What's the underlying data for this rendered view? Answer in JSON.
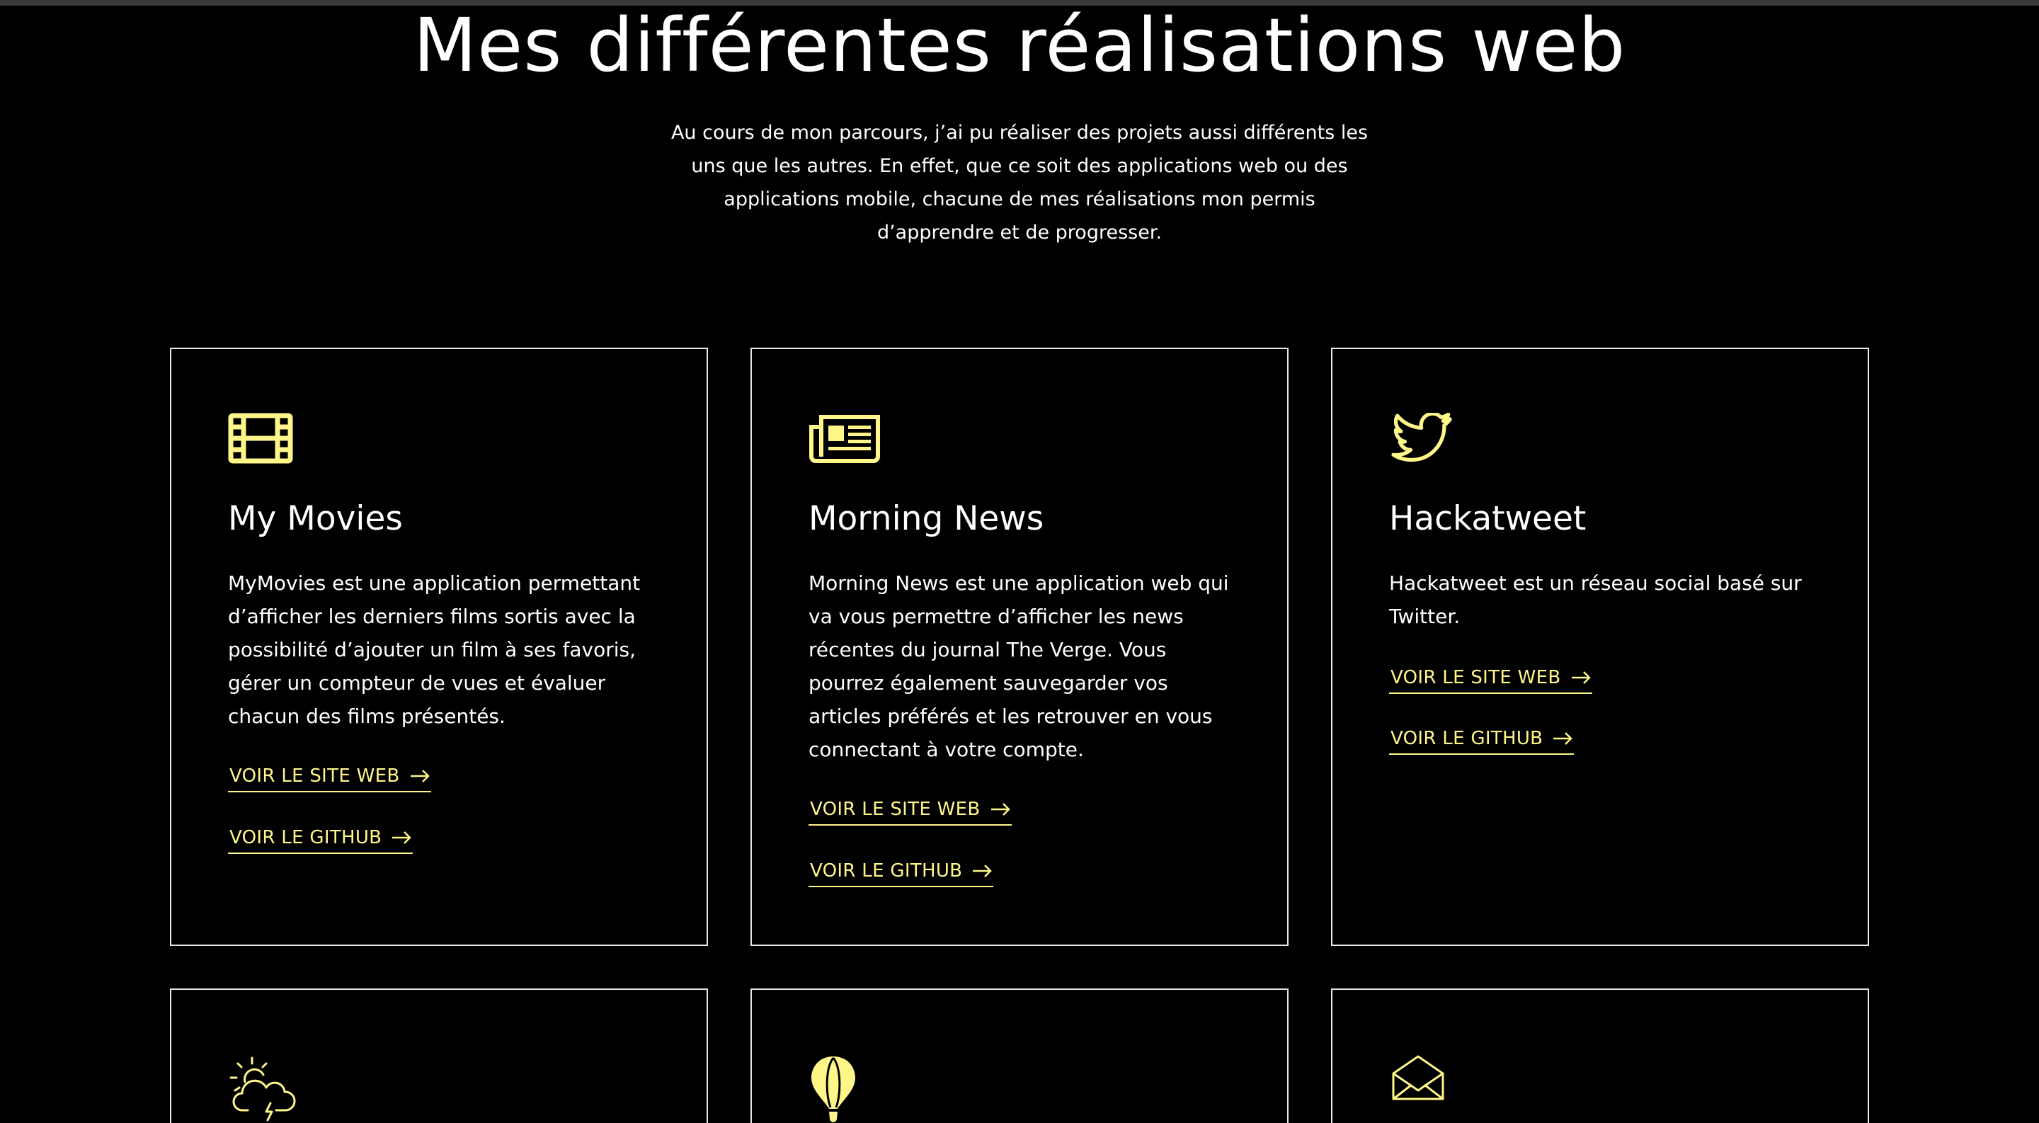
{
  "page": {
    "title": "Mes différentes réalisations web",
    "intro": "Au cours de mon parcours, j’ai pu réaliser des projets aussi différents les uns que les autres. En effet, que ce soit des applications web ou des applications mobile, chacune de mes réalisations mon permis d’apprendre et de progresser."
  },
  "colors": {
    "background": "#000000",
    "accent": "#fff68a",
    "text": "#ffffff",
    "border": "#e8e8e8"
  },
  "projects": [
    {
      "icon": "film-icon",
      "title": "My Movies",
      "description": "MyMovies est une application permettant d’afficher les derniers films sortis avec la possibilité d’ajouter un film à ses favoris, gérer un compteur de vues et évaluer chacun des films présentés.",
      "site_label": "VOIR LE SITE WEB",
      "github_label": "VOIR LE GITHUB"
    },
    {
      "icon": "newspaper-icon",
      "title": "Morning News",
      "description": "Morning News est une application web qui va vous permettre d’afficher les news récentes du journal The Verge. Vous pourrez également sauvegarder vos articles préférés et les retrouver en vous connectant à votre compte.",
      "site_label": "VOIR LE SITE WEB",
      "github_label": "VOIR LE GITHUB"
    },
    {
      "icon": "twitter-icon",
      "title": "Hackatweet",
      "description": "Hackatweet est un réseau social basé sur Twitter.",
      "site_label": "VOIR LE SITE WEB",
      "github_label": "VOIR LE GITHUB"
    },
    {
      "icon": "weather-storm-icon"
    },
    {
      "icon": "hot-air-balloon-icon"
    },
    {
      "icon": "envelope-icon"
    }
  ]
}
